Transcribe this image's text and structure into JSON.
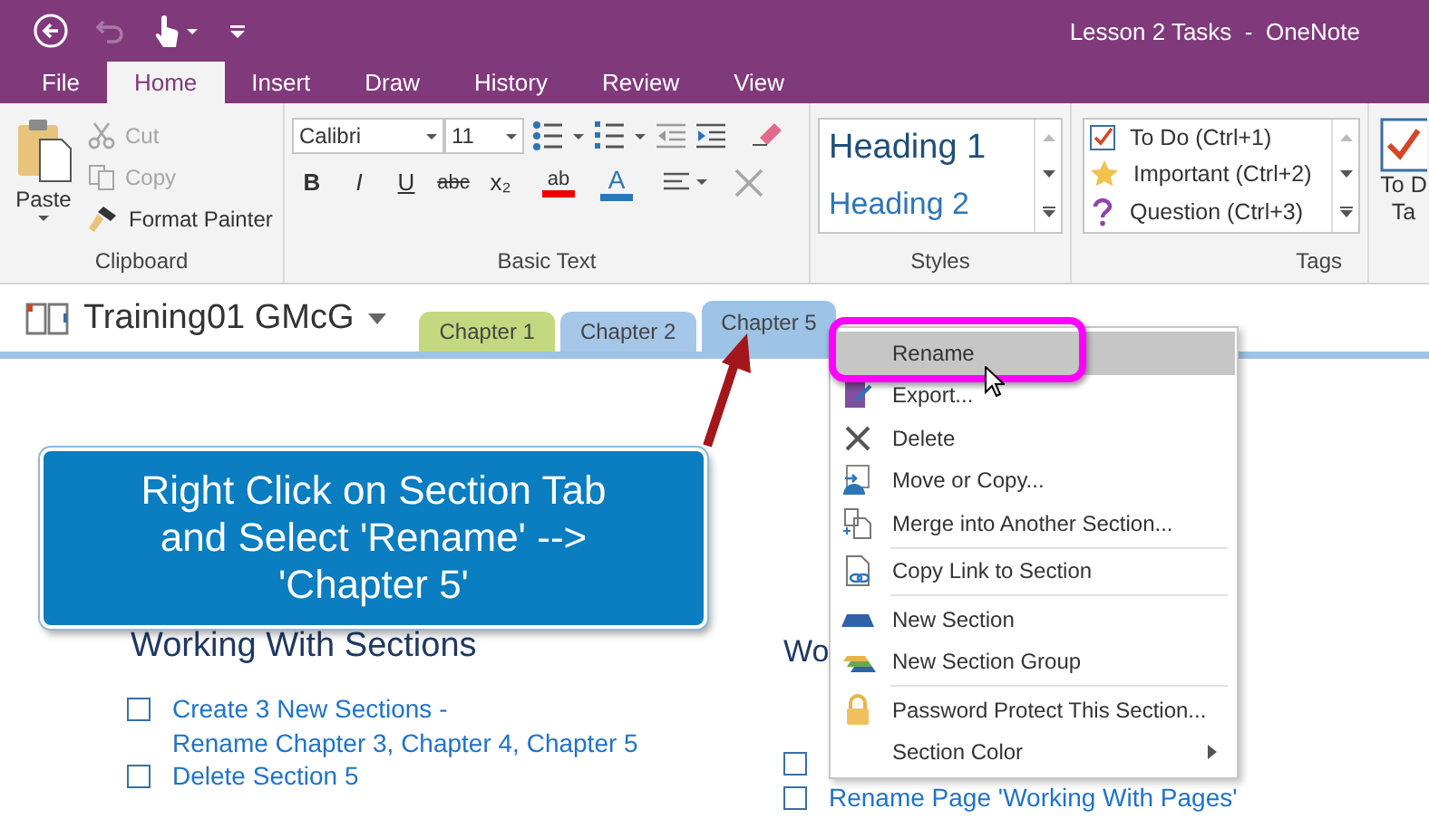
{
  "title_bar": {
    "title": "Lesson 2 Tasks  -  OneNote"
  },
  "ribbon_tabs": [
    {
      "label": "File",
      "selected": false
    },
    {
      "label": "Home",
      "selected": true
    },
    {
      "label": "Insert",
      "selected": false
    },
    {
      "label": "Draw",
      "selected": false
    },
    {
      "label": "History",
      "selected": false
    },
    {
      "label": "Review",
      "selected": false
    },
    {
      "label": "View",
      "selected": false
    }
  ],
  "clipboard": {
    "paste": "Paste",
    "cut": {
      "label": "Cut",
      "disabled": true
    },
    "copy": {
      "label": "Copy",
      "disabled": true
    },
    "format_painter": {
      "label": "Format Painter",
      "disabled": false
    },
    "group": "Clipboard"
  },
  "basic_text": {
    "font": "Calibri",
    "size": "11",
    "format_buttons": [
      "B",
      "I",
      "U",
      "abc",
      "x₂"
    ],
    "highlight": "ab",
    "font_color": "A",
    "group": "Basic Text"
  },
  "styles": {
    "items": [
      "Heading 1",
      "Heading 2"
    ],
    "group": "Styles"
  },
  "tags": {
    "items": [
      {
        "label": "To Do (Ctrl+1)",
        "kind": "todo"
      },
      {
        "label": "Important (Ctrl+2)",
        "kind": "important"
      },
      {
        "label": "Question (Ctrl+3)",
        "kind": "question"
      }
    ],
    "group": "Tags",
    "todo_button": [
      "To D",
      "Ta"
    ]
  },
  "notebook": {
    "name": "Training01 GMcG"
  },
  "sections": [
    {
      "label": "Chapter 1",
      "color": "#c4d97f",
      "selected": false
    },
    {
      "label": "Chapter 2",
      "color": "#a6c6e8",
      "selected": false
    },
    {
      "label": "Chapter 5",
      "color": "#9dc3e6",
      "selected": true
    }
  ],
  "page": {
    "columns": [
      {
        "title": "Working With Sections",
        "tasks": [
          {
            "text": "Create 3 New Sections -\nRename Chapter 3, Chapter 4, Chapter 5",
            "checked": false
          },
          {
            "text": "Delete Section 5",
            "checked": false
          }
        ]
      },
      {
        "title": "Wo",
        "tasks": [
          {
            "checked": false
          },
          {
            "text": "Rename Page 'Working With Pages'",
            "checked": false
          }
        ]
      }
    ]
  },
  "callout": {
    "text": "Right Click on Section Tab and Select 'Rename' --> 'Chapter 5'"
  },
  "context_menu": [
    {
      "label": "Rename",
      "kind": "rename",
      "selected": true,
      "separator_before": false,
      "submenu": false
    },
    {
      "label": "Export...",
      "kind": "export",
      "selected": false,
      "separator_before": false,
      "submenu": false
    },
    {
      "label": "Delete",
      "kind": "delete",
      "selected": false,
      "separator_before": false,
      "submenu": false
    },
    {
      "label": "Move or Copy...",
      "kind": "move",
      "selected": false,
      "separator_before": false,
      "submenu": false
    },
    {
      "label": "Merge into Another Section...",
      "kind": "merge",
      "selected": false,
      "separator_before": false,
      "submenu": false
    },
    {
      "label": "Copy Link to Section",
      "kind": "link",
      "selected": false,
      "separator_before": true,
      "submenu": false
    },
    {
      "label": "New Section",
      "kind": "new-section",
      "selected": false,
      "separator_before": true,
      "submenu": false
    },
    {
      "label": "New Section Group",
      "kind": "new-group",
      "selected": false,
      "separator_before": false,
      "submenu": false
    },
    {
      "label": "Password Protect This Section...",
      "kind": "lock",
      "selected": false,
      "separator_before": true,
      "submenu": false
    },
    {
      "label": "Section Color",
      "kind": "color",
      "selected": false,
      "separator_before": false,
      "submenu": true
    }
  ]
}
